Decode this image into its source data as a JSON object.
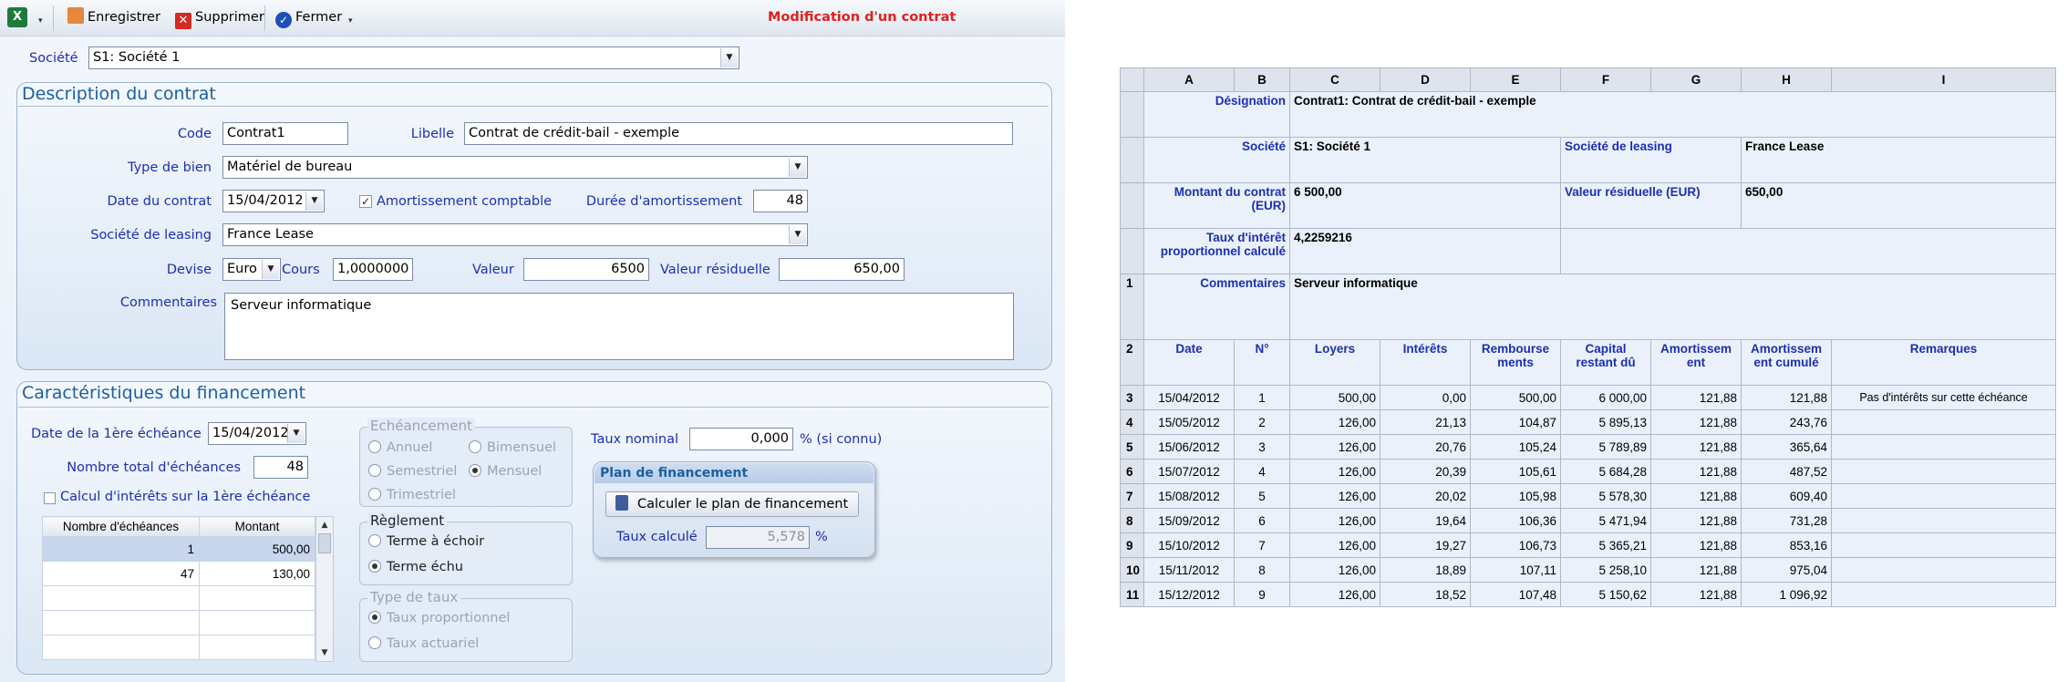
{
  "toolbar": {
    "save_label": "Enregistrer",
    "delete_label": "Supprimer",
    "close_label": "Fermer",
    "title": "Modification d'un contrat"
  },
  "societe": {
    "label": "Société",
    "value": "S1: Société 1"
  },
  "description": {
    "title": "Description du contrat",
    "code_label": "Code",
    "code": "Contrat1",
    "libelle_label": "Libelle",
    "libelle": "Contrat de crédit-bail - exemple",
    "type_bien_label": "Type de bien",
    "type_bien": "Matériel de bureau",
    "date_label": "Date du contrat",
    "date": "15/04/2012",
    "amort_label": "Amortissement comptable",
    "duree_label": "Durée d'amortissement",
    "duree": "48",
    "leasing_label": "Société de leasing",
    "leasing": "France Lease",
    "devise_label": "Devise",
    "devise": "Euro",
    "cours_label": "Cours",
    "cours": "1,0000000",
    "valeur_label": "Valeur",
    "valeur": "6500",
    "residuelle_label": "Valeur résiduelle",
    "residuelle": "650,00",
    "comments_label": "Commentaires",
    "comments": "Serveur informatique"
  },
  "financement": {
    "title": "Caractéristiques du financement",
    "first_date_label": "Date de la 1ère échéance",
    "first_date": "15/04/2012",
    "nb_label": "Nombre total d'échéances",
    "nb": "48",
    "calc_label": "Calcul d'intérêts sur la 1ère échéance",
    "grid_headers": [
      "Nombre d'échéances",
      "Montant"
    ],
    "grid_rows": [
      [
        "1",
        "500,00"
      ],
      [
        "47",
        "130,00"
      ],
      [
        "",
        ""
      ],
      [
        "",
        ""
      ],
      [
        "",
        ""
      ],
      [
        "",
        ""
      ]
    ],
    "echeancement_title": "Echéancement",
    "annuel": "Annuel",
    "bimensuel": "Bimensuel",
    "semestriel": "Semestriel",
    "mensuel": "Mensuel",
    "trimestriel": "Trimestriel",
    "reglement_title": "Règlement",
    "echoir": "Terme à échoir",
    "echu": "Terme échu",
    "taux_type_title": "Type de taux",
    "proportionnel": "Taux proportionnel",
    "actuariel": "Taux actuariel",
    "taux_nominal_label": "Taux nominal",
    "taux_nominal": "0,000",
    "taux_nominal_suffix": "% (si connu)",
    "plan_title": "Plan de financement",
    "plan_button": "Calculer le plan de financement",
    "taux_calcule_label": "Taux calculé",
    "taux_calcule": "5,578",
    "pct": "%"
  },
  "sheet": {
    "cols": [
      "A",
      "B",
      "C",
      "D",
      "E",
      "F",
      "G",
      "H",
      "I"
    ],
    "designation_label": "Désignation",
    "designation": "Contrat1: Contrat de crédit-bail - exemple",
    "societe_label": "Société",
    "societe": "S1: Société 1",
    "leasing_label": "Société de leasing",
    "leasing": "France Lease",
    "montant_label": "Montant du contrat (EUR)",
    "montant": "6 500,00",
    "residuelle_label": "Valeur résiduelle (EUR)",
    "residuelle": "650,00",
    "taux_label": "Taux d'intérêt proportionnel calculé",
    "taux": "4,2259216",
    "comments_label": "Commentaires",
    "comments": "Serveur informatique",
    "headers": [
      "Date",
      "N°",
      "Loyers",
      "Intérêts",
      "Rembourse ments",
      "Capital restant dû",
      "Amortissem ent",
      "Amortissem ent cumulé",
      "Remarques"
    ],
    "rows": [
      [
        "3",
        "15/04/2012",
        "1",
        "500,00",
        "0,00",
        "500,00",
        "6 000,00",
        "121,88",
        "121,88",
        "Pas d'intérêts sur cette échéance"
      ],
      [
        "4",
        "15/05/2012",
        "2",
        "126,00",
        "21,13",
        "104,87",
        "5 895,13",
        "121,88",
        "243,76",
        ""
      ],
      [
        "5",
        "15/06/2012",
        "3",
        "126,00",
        "20,76",
        "105,24",
        "5 789,89",
        "121,88",
        "365,64",
        ""
      ],
      [
        "6",
        "15/07/2012",
        "4",
        "126,00",
        "20,39",
        "105,61",
        "5 684,28",
        "121,88",
        "487,52",
        ""
      ],
      [
        "7",
        "15/08/2012",
        "5",
        "126,00",
        "20,02",
        "105,98",
        "5 578,30",
        "121,88",
        "609,40",
        ""
      ],
      [
        "8",
        "15/09/2012",
        "6",
        "126,00",
        "19,64",
        "106,36",
        "5 471,94",
        "121,88",
        "731,28",
        ""
      ],
      [
        "9",
        "15/10/2012",
        "7",
        "126,00",
        "19,27",
        "106,73",
        "5 365,21",
        "121,88",
        "853,16",
        ""
      ],
      [
        "10",
        "15/11/2012",
        "8",
        "126,00",
        "18,89",
        "107,11",
        "5 258,10",
        "121,88",
        "975,04",
        ""
      ],
      [
        "11",
        "15/12/2012",
        "9",
        "126,00",
        "18,52",
        "107,48",
        "5 150,62",
        "121,88",
        "1 096,92",
        ""
      ]
    ]
  }
}
